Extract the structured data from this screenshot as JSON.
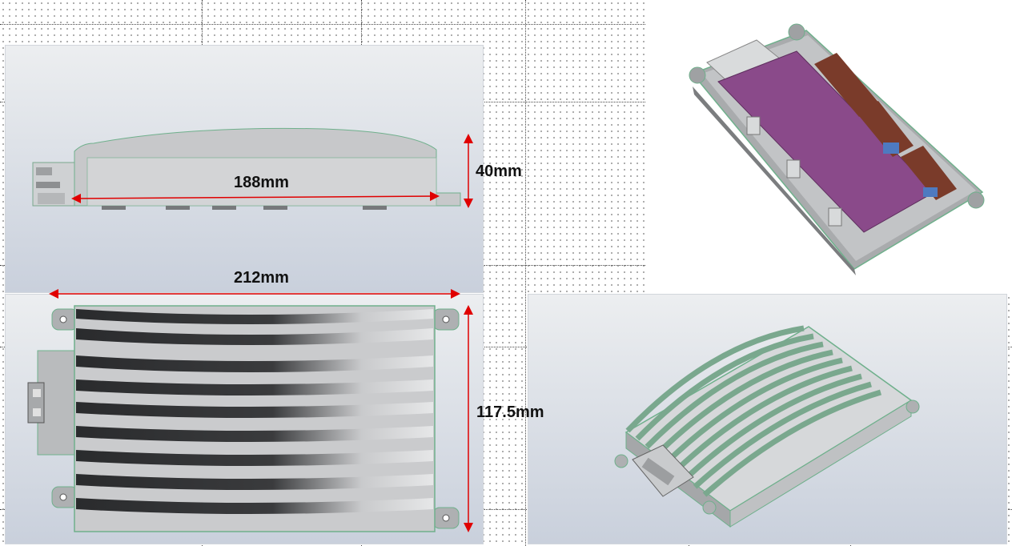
{
  "dimensions": {
    "side_length": "188mm",
    "height": "40mm",
    "total_length": "212mm",
    "width": "117.5mm"
  },
  "colors": {
    "dimension_arrow": "#e00000",
    "housing": "#c8cacc",
    "housing_edge": "#6fb08c",
    "fin_dark": "#2e2f31",
    "pcb": "#8a4a8a",
    "capacitor": "#7a3b2a"
  }
}
